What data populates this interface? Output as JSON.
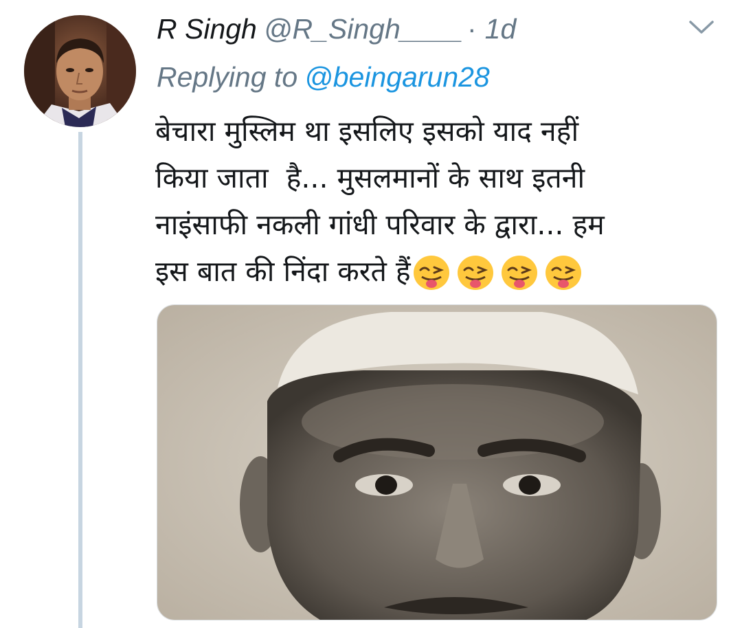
{
  "tweet": {
    "display_name": "R Singh",
    "handle": "@R_Singh____",
    "separator": "·",
    "timestamp": "1d",
    "replying_to_prefix": "Replying to",
    "replying_to_handle": "@beingarun28",
    "text": "बेचारा मुस्लिम था इसलिए इसको याद नहीं\nकिया जाता  है... मुसलमानों के साथ इतनी\nनाइंसाफी नकली गांधी परिवार के द्वारा... हम\nइस बात की निंदा करते हैं",
    "emojis": [
      "winking-face-with-tongue",
      "winking-face-with-tongue",
      "winking-face-with-tongue",
      "winking-face-with-tongue"
    ],
    "media_type": "photo"
  },
  "icons": {
    "menu": "chevron-down-icon",
    "avatar": "profile-photo"
  },
  "colors": {
    "primary_text": "#14171a",
    "secondary_text": "#657786",
    "link": "#1b95e0",
    "thread_line": "#c7d5e1",
    "emoji_face": "#ffc83d"
  }
}
